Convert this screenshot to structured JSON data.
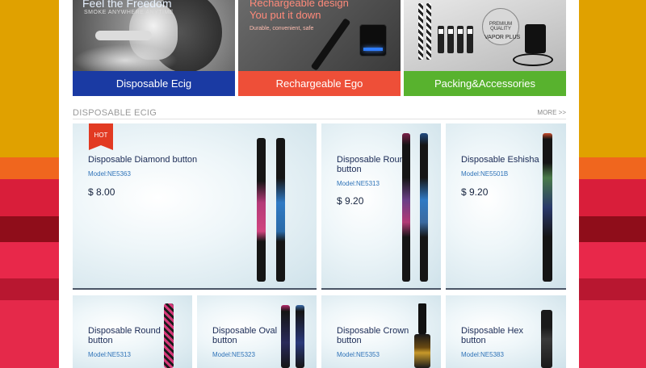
{
  "banners": [
    {
      "label": "Disposable Ecig",
      "headline": "Feel the Freedom",
      "subline": "SMOKE ANYWHERE ANYTIME",
      "color": "#1a3aa3"
    },
    {
      "label": "Rechargeable Ego",
      "headline_line1": "Rechargeable design",
      "headline_line2": "You put it down",
      "subline": "Durable, convenient, safe",
      "color": "#ee4f38"
    },
    {
      "label": "Packing&Accessories",
      "badge_line1": "PREMIUM",
      "badge_line2": "QUALITY",
      "box_label": "VAPOR PLUS",
      "color": "#58b22e"
    }
  ],
  "section": {
    "title": "DISPOSABLE ECIG",
    "more": "MORE >>"
  },
  "products": [
    {
      "title": "Disposable Diamond button",
      "model": "Model:NE5363",
      "price": "$ 8.00",
      "badge": "HOT"
    },
    {
      "title": "Disposable Round button",
      "model": "Model:NE5313",
      "price": "$ 9.20"
    },
    {
      "title": "Disposable Eshisha",
      "model": "Model:NE5501B",
      "price": "$ 9.20"
    },
    {
      "title": "Disposable Round button",
      "model": "Model:NE5313"
    },
    {
      "title": "Disposable Oval button",
      "model": "Model:NE5323"
    },
    {
      "title": "Disposable Crown button",
      "model": "Model:NE5353"
    },
    {
      "title": "Disposable Hex button",
      "model": "Model:NE5383"
    }
  ],
  "colors": {
    "accent_blue": "#1a3aa3",
    "accent_red": "#ee4f38",
    "accent_green": "#58b22e",
    "hot_badge": "#e23a22",
    "model_text": "#2f73b8"
  }
}
